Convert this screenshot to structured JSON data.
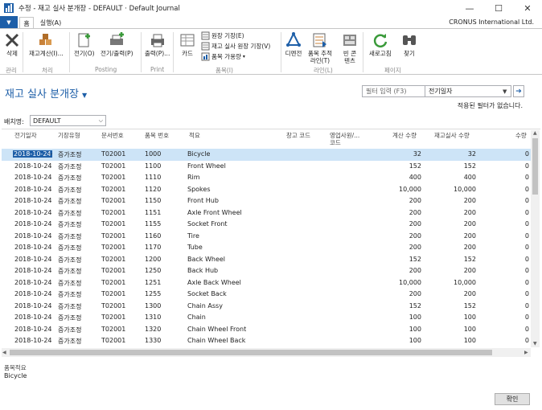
{
  "window": {
    "title": "수정 - 재고 실사 분개장 - DEFAULT · Default Journal",
    "minimize": "—",
    "maximize": "☐",
    "close": "✕"
  },
  "tabs": [
    {
      "label": "홈"
    },
    {
      "label": "실행(A)"
    }
  ],
  "company": "CRONUS International Ltd.",
  "ribbon": {
    "delete": "삭제",
    "calc_inventory": "재고계산(I)...",
    "post": "전기(O)",
    "post_print": "전기/출력(P)",
    "print": "출력(P)...",
    "card": "카드",
    "ledger_entries": "원장 기장(E)",
    "phys_ledger": "재고 실사 원장 기장(V)",
    "item_availability": "품목 가용량",
    "dimensions": "디멘전",
    "item_tracking_line1": "품목 추적",
    "item_tracking_line2": "라인(T)",
    "bin_contents_line1": "빈 콘",
    "bin_contents_line2": "텐츠",
    "refresh": "새로고침",
    "find": "찾기",
    "groups": {
      "manage": "관리",
      "process": "처리",
      "posting": "Posting",
      "print": "Print",
      "item": "품목(I)",
      "line": "라인(L)",
      "page": "페이지"
    }
  },
  "page_title": "재고 실사 분개장",
  "filter": {
    "placeholder": "필터 입력 (F3)",
    "field": "전기일자",
    "no_filter": "적용된 필터가 없습니다."
  },
  "batch": {
    "label": "배치명:",
    "value": "DEFAULT"
  },
  "columns": {
    "posting_date": "전기일자",
    "entry_type": "기장유형",
    "document_no": "문서번호",
    "item_no": "품목 번호",
    "description": "적요",
    "location": "창고 코드",
    "salesperson_1": "영업사원/...",
    "salesperson_2": "코드",
    "qty_calc": "계산 수량",
    "qty_phys": "재고실사 수량",
    "qty": "수량"
  },
  "rows": [
    {
      "date": "2018-10-24",
      "type": "증가조정",
      "doc": "T02001",
      "item": "1000",
      "desc": "Bicycle",
      "calc": "32",
      "phys": "32",
      "qty": "0"
    },
    {
      "date": "2018-10-24",
      "type": "증가조정",
      "doc": "T02001",
      "item": "1100",
      "desc": "Front Wheel",
      "calc": "152",
      "phys": "152",
      "qty": "0"
    },
    {
      "date": "2018-10-24",
      "type": "증가조정",
      "doc": "T02001",
      "item": "1110",
      "desc": "Rim",
      "calc": "400",
      "phys": "400",
      "qty": "0"
    },
    {
      "date": "2018-10-24",
      "type": "증가조정",
      "doc": "T02001",
      "item": "1120",
      "desc": "Spokes",
      "calc": "10,000",
      "phys": "10,000",
      "qty": "0"
    },
    {
      "date": "2018-10-24",
      "type": "증가조정",
      "doc": "T02001",
      "item": "1150",
      "desc": "Front Hub",
      "calc": "200",
      "phys": "200",
      "qty": "0"
    },
    {
      "date": "2018-10-24",
      "type": "증가조정",
      "doc": "T02001",
      "item": "1151",
      "desc": "Axle Front Wheel",
      "calc": "200",
      "phys": "200",
      "qty": "0"
    },
    {
      "date": "2018-10-24",
      "type": "증가조정",
      "doc": "T02001",
      "item": "1155",
      "desc": "Socket Front",
      "calc": "200",
      "phys": "200",
      "qty": "0"
    },
    {
      "date": "2018-10-24",
      "type": "증가조정",
      "doc": "T02001",
      "item": "1160",
      "desc": "Tire",
      "calc": "200",
      "phys": "200",
      "qty": "0"
    },
    {
      "date": "2018-10-24",
      "type": "증가조정",
      "doc": "T02001",
      "item": "1170",
      "desc": "Tube",
      "calc": "200",
      "phys": "200",
      "qty": "0"
    },
    {
      "date": "2018-10-24",
      "type": "증가조정",
      "doc": "T02001",
      "item": "1200",
      "desc": "Back Wheel",
      "calc": "152",
      "phys": "152",
      "qty": "0"
    },
    {
      "date": "2018-10-24",
      "type": "증가조정",
      "doc": "T02001",
      "item": "1250",
      "desc": "Back Hub",
      "calc": "200",
      "phys": "200",
      "qty": "0"
    },
    {
      "date": "2018-10-24",
      "type": "증가조정",
      "doc": "T02001",
      "item": "1251",
      "desc": "Axle Back Wheel",
      "calc": "10,000",
      "phys": "10,000",
      "qty": "0"
    },
    {
      "date": "2018-10-24",
      "type": "증가조정",
      "doc": "T02001",
      "item": "1255",
      "desc": "Socket Back",
      "calc": "200",
      "phys": "200",
      "qty": "0"
    },
    {
      "date": "2018-10-24",
      "type": "증가조정",
      "doc": "T02001",
      "item": "1300",
      "desc": "Chain Assy",
      "calc": "152",
      "phys": "152",
      "qty": "0"
    },
    {
      "date": "2018-10-24",
      "type": "증가조정",
      "doc": "T02001",
      "item": "1310",
      "desc": "Chain",
      "calc": "100",
      "phys": "100",
      "qty": "0"
    },
    {
      "date": "2018-10-24",
      "type": "증가조정",
      "doc": "T02001",
      "item": "1320",
      "desc": "Chain Wheel Front",
      "calc": "100",
      "phys": "100",
      "qty": "0"
    },
    {
      "date": "2018-10-24",
      "type": "증가조정",
      "doc": "T02001",
      "item": "1330",
      "desc": "Chain Wheel Back",
      "calc": "100",
      "phys": "100",
      "qty": "0"
    }
  ],
  "footer": {
    "desc_label": "품목적요",
    "desc_value": "Bicycle",
    "ok": "확인"
  },
  "colors": {
    "accent": "#1e5fa8",
    "selected_row": "#cde4f7"
  }
}
